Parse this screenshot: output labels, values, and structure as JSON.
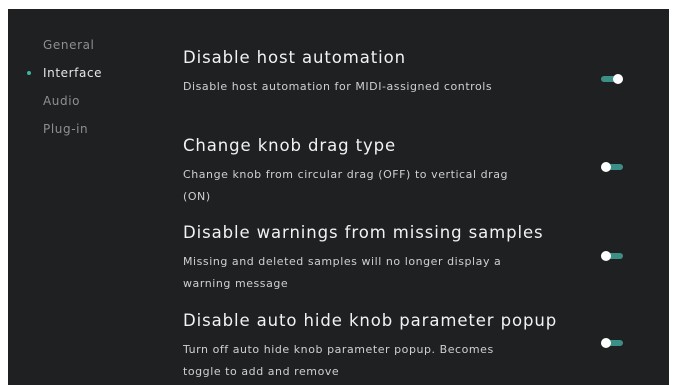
{
  "sidebar": {
    "items": [
      {
        "label": "General",
        "active": false
      },
      {
        "label": "Interface",
        "active": true
      },
      {
        "label": "Audio",
        "active": false
      },
      {
        "label": "Plug-in",
        "active": false
      }
    ]
  },
  "settings": [
    {
      "title": "Disable host automation",
      "description": "Disable host automation for MIDI-assigned controls",
      "toggle_state": "on"
    },
    {
      "title": "Change knob drag type",
      "description": "Change knob from circular drag (OFF) to vertical drag (ON)",
      "toggle_state": "off"
    },
    {
      "title": "Disable warnings from missing samples",
      "description": "Missing and deleted samples will no longer display a warning message",
      "toggle_state": "off"
    },
    {
      "title": "Disable auto hide knob parameter popup",
      "description": "Turn off auto hide knob parameter popup. Becomes toggle to add and remove",
      "toggle_state": "off"
    }
  ],
  "colors": {
    "background": "#1e2021",
    "accent": "#3fb3a2",
    "toggle_track": "#3c8f87",
    "toggle_knob": "#ffffff",
    "nav_inactive": "#8d8f90",
    "nav_active": "#e6e6e6"
  }
}
